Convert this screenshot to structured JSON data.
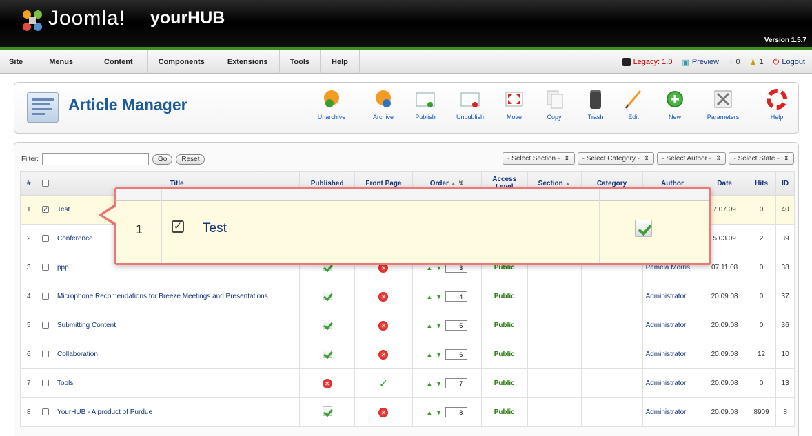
{
  "header": {
    "logo_text": "Joomla!",
    "site_name": "yourHUB",
    "version": "Version 1.5.7"
  },
  "menu": [
    "Site",
    "Menus",
    "Content",
    "Components",
    "Extensions",
    "Tools",
    "Help"
  ],
  "status": {
    "legacy": "Legacy: 1.0",
    "preview": "Preview",
    "messages": "0",
    "users": "1",
    "logout": "Logout"
  },
  "toolbar": {
    "title": "Article Manager",
    "buttons": [
      {
        "label": "Unarchive",
        "icon": "unarchive-icon"
      },
      {
        "label": "Archive",
        "icon": "archive-icon"
      },
      {
        "label": "Publish",
        "icon": "publish-icon"
      },
      {
        "label": "Unpublish",
        "icon": "unpublish-icon"
      },
      {
        "label": "Move",
        "icon": "move-icon"
      },
      {
        "label": "Copy",
        "icon": "copy-icon"
      },
      {
        "label": "Trash",
        "icon": "trash-icon"
      },
      {
        "label": "Edit",
        "icon": "edit-icon"
      },
      {
        "label": "New",
        "icon": "new-icon"
      },
      {
        "label": "Parameters",
        "icon": "parameters-icon"
      },
      {
        "label": "Help",
        "icon": "help-icon"
      }
    ]
  },
  "filter": {
    "label": "Filter:",
    "value": "",
    "go": "Go",
    "reset": "Reset"
  },
  "selects": [
    "- Select Section -",
    "- Select Category -",
    "- Select Author -",
    "- Select State -"
  ],
  "columns": [
    "#",
    "",
    "Title",
    "Published",
    "Front Page",
    "Order",
    "Access Level",
    "Section",
    "Category",
    "Author",
    "Date",
    "Hits",
    "ID"
  ],
  "rows": [
    {
      "num": "1",
      "checked": true,
      "title": "Test",
      "published": "yes",
      "front": "",
      "order": "",
      "access": "",
      "author": "",
      "date": "7.07.09",
      "hits": "0",
      "id": "40"
    },
    {
      "num": "2",
      "checked": false,
      "title": "Conference",
      "published": "",
      "front": "",
      "order": "",
      "access": "",
      "author": "",
      "date": "5.03.09",
      "hits": "2",
      "id": "39"
    },
    {
      "num": "3",
      "checked": false,
      "title": "ppp",
      "published": "yes",
      "front": "no",
      "order": "3",
      "access": "Public",
      "author": "Pamela Morris",
      "date": "07.11.08",
      "hits": "0",
      "id": "38"
    },
    {
      "num": "4",
      "checked": false,
      "title": "Microphone Recomendations for Breeze Meetings and Presentations",
      "published": "yes",
      "front": "no",
      "order": "4",
      "access": "Public",
      "author": "Administrator",
      "date": "20.09.08",
      "hits": "0",
      "id": "37"
    },
    {
      "num": "5",
      "checked": false,
      "title": "Submitting Content",
      "published": "yes",
      "front": "no",
      "order": "5",
      "access": "Public",
      "author": "Administrator",
      "date": "20.09.08",
      "hits": "0",
      "id": "36"
    },
    {
      "num": "6",
      "checked": false,
      "title": "Collaboration",
      "published": "yes",
      "front": "no",
      "order": "6",
      "access": "Public",
      "author": "Administrator",
      "date": "20.09.08",
      "hits": "12",
      "id": "10"
    },
    {
      "num": "7",
      "checked": false,
      "title": "Tools",
      "published": "no",
      "front": "yes",
      "order": "7",
      "access": "Public",
      "author": "Administrator",
      "date": "20.09.08",
      "hits": "0",
      "id": "13"
    },
    {
      "num": "8",
      "checked": false,
      "title": "YourHUB - A product of Purdue",
      "published": "yes",
      "front": "no",
      "order": "8",
      "access": "Public",
      "author": "Administrator",
      "date": "20.09.08",
      "hits": "8909",
      "id": "8"
    }
  ],
  "zoom": {
    "num": "1",
    "title": "Test"
  }
}
